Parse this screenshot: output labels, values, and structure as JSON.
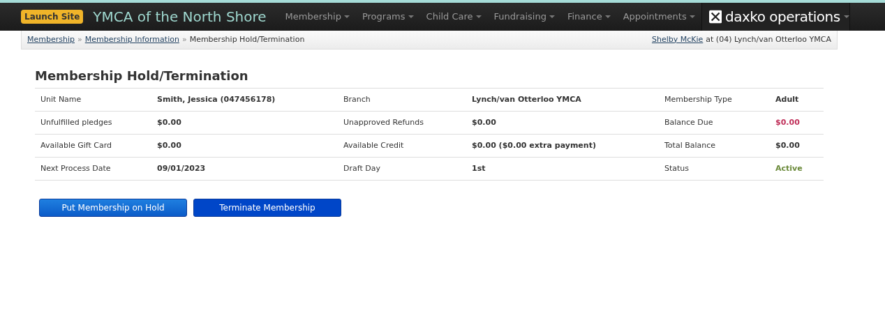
{
  "navbar": {
    "launch_button": "Launch Site",
    "site_title": "YMCA of the North Shore",
    "menus": [
      "Membership",
      "Programs",
      "Child Care",
      "Fundraising",
      "Finance",
      "Appointments"
    ],
    "brand": "daxko operations"
  },
  "breadcrumb": {
    "links": [
      "Membership",
      "Membership Information"
    ],
    "separator": "»",
    "current": "Membership Hold/Termination",
    "user_link": "Shelby McKie",
    "user_location": "at (04) Lynch/van Otterloo YMCA"
  },
  "heading": "Membership Hold/Termination",
  "details": [
    [
      {
        "label": "Unit Name",
        "value": "Smith, Jessica (047456178)",
        "color": "#333333"
      },
      {
        "label": "Branch",
        "value": "Lynch/van Otterloo YMCA",
        "color": "#333333"
      },
      {
        "label": "Membership Type",
        "value": "Adult",
        "color": "#333333"
      }
    ],
    [
      {
        "label": "Unfulfilled pledges",
        "value": "$0.00",
        "color": "#333333"
      },
      {
        "label": "Unapproved Refunds",
        "value": "$0.00",
        "color": "#333333"
      },
      {
        "label": "Balance Due",
        "value": "$0.00",
        "color": "#c0305a"
      }
    ],
    [
      {
        "label": "Available Gift Card",
        "value": "$0.00",
        "color": "#333333"
      },
      {
        "label": "Available Credit",
        "value": "$0.00 ($0.00 extra payment)",
        "color": "#333333"
      },
      {
        "label": "Total Balance",
        "value": "$0.00",
        "color": "#333333"
      }
    ],
    [
      {
        "label": "Next Process Date",
        "value": "09/01/2023",
        "color": "#333333"
      },
      {
        "label": "Draft Day",
        "value": "1st",
        "color": "#333333"
      },
      {
        "label": "Status",
        "value": "Active",
        "color": "#6b8a3a"
      }
    ]
  ],
  "buttons": [
    {
      "label": "Put Membership on Hold",
      "kind": "light"
    },
    {
      "label": "Terminate Membership",
      "kind": "dark"
    }
  ]
}
